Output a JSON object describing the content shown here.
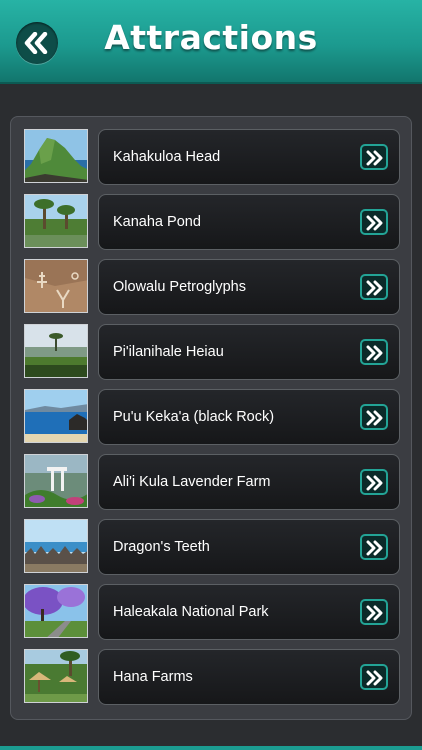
{
  "header": {
    "title": "Attractions",
    "back_icon": "double-chevron-left-icon",
    "accent_color": "#1c9a8f"
  },
  "list": {
    "items": [
      {
        "label": "Kahakuloa Head",
        "thumb": "coastal-headland-photo"
      },
      {
        "label": "Kanaha Pond",
        "thumb": "pond-palms-photo"
      },
      {
        "label": "Olowalu Petroglyphs",
        "thumb": "petroglyph-rock-photo"
      },
      {
        "label": "Pi'ilanihale Heiau",
        "thumb": "heiau-landscape-photo"
      },
      {
        "label": "Pu'u Keka'a (black Rock)",
        "thumb": "black-rock-beach-photo"
      },
      {
        "label": "Ali'i Kula Lavender Farm",
        "thumb": "lavender-farm-photo"
      },
      {
        "label": "Dragon's Teeth",
        "thumb": "dragons-teeth-photo"
      },
      {
        "label": "Haleakala National Park",
        "thumb": "jacaranda-park-photo"
      },
      {
        "label": "Hana Farms",
        "thumb": "hana-farms-photo"
      }
    ],
    "go_icon": "double-chevron-right-icon"
  }
}
